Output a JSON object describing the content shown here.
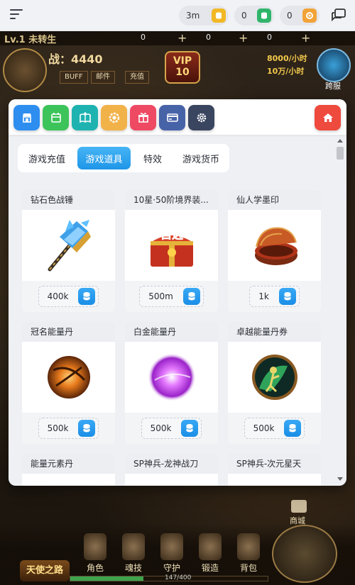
{
  "topbar": {
    "currencies": [
      {
        "value": "3m",
        "icon": "gold-coin-icon",
        "color": "#f2b824"
      },
      {
        "value": "0",
        "icon": "green-gem-icon",
        "color": "#2fb56a"
      },
      {
        "value": "0",
        "icon": "orange-badge-icon",
        "color": "#f2a338"
      }
    ]
  },
  "game": {
    "level": "Lv.1 未转生",
    "resources": [
      "0",
      "0",
      "0"
    ],
    "power": "战：4440",
    "buttons": [
      "BUFF",
      "邮件",
      "充值"
    ],
    "vip": "VIP\n10",
    "rates": [
      "8000/小时",
      "10万/小时"
    ],
    "cross_label": "跨服",
    "shop_label": "商城",
    "nav": [
      "角色",
      "魂技",
      "守护",
      "锻造",
      "背包"
    ],
    "angel": "天使之路",
    "exp_text": "147/400",
    "exp_progress": 0.37
  },
  "modal": {
    "header_buttons": [
      {
        "name": "shop-icon",
        "color": "#2d8ef0"
      },
      {
        "name": "calendar-icon",
        "color": "#3cc45a"
      },
      {
        "name": "book-icon",
        "color": "#1eb3b0"
      },
      {
        "name": "badge-icon",
        "color": "#f2b24a"
      },
      {
        "name": "gift-icon",
        "color": "#ef4a63"
      },
      {
        "name": "card-icon",
        "color": "#4763a8"
      },
      {
        "name": "settings-icon",
        "color": "#3a4560"
      }
    ],
    "home_color": "#ee4a3e",
    "tabs": [
      "游戏充值",
      "游戏道具",
      "特效",
      "游戏货币"
    ],
    "active_tab": 1,
    "items": [
      {
        "title": "钻石色战锤",
        "price": "400k",
        "img": "hammer"
      },
      {
        "title": "10星·50阶境界装...",
        "price": "500m",
        "img": "chest"
      },
      {
        "title": "仙人学墨印",
        "price": "1k",
        "img": "box"
      },
      {
        "title": "冠名能量丹",
        "price": "500k",
        "img": "orb-orange"
      },
      {
        "title": "白金能量丹",
        "price": "500k",
        "img": "orb-purple"
      },
      {
        "title": "卓越能量丹券",
        "price": "500k",
        "img": "coin-green"
      },
      {
        "title": "能量元素丹",
        "price": "",
        "img": ""
      },
      {
        "title": "SP神兵-龙神战刀",
        "price": "",
        "img": ""
      },
      {
        "title": "SP神兵-次元星天",
        "price": "",
        "img": ""
      }
    ]
  }
}
